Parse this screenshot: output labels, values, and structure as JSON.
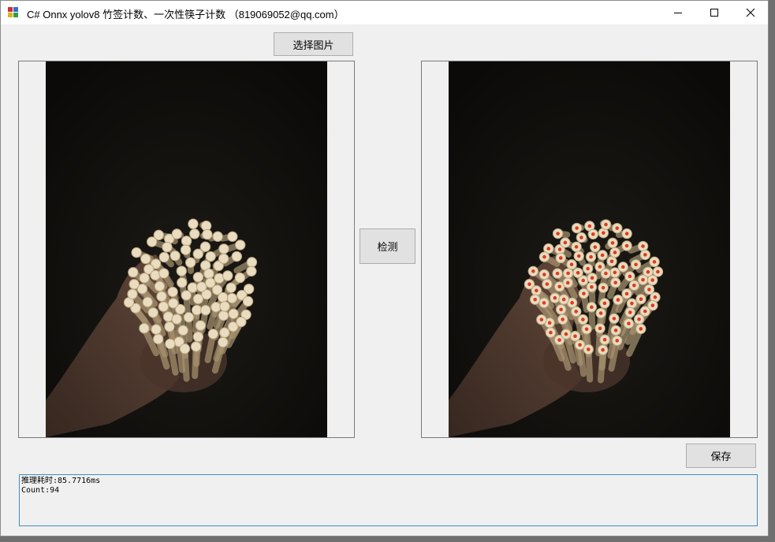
{
  "window": {
    "title": "C# Onnx yolov8 竹签计数、一次性筷子计数 （819069052@qq.com）",
    "controls": {
      "minimize": "minimize-icon",
      "maximize": "maximize-icon",
      "close": "close-icon"
    },
    "app_icon": "app-icon"
  },
  "buttons": {
    "select_image": "选择图片",
    "detect": "检测",
    "save": "保存"
  },
  "output": {
    "lines": [
      "推理耗时:85.7716ms",
      "Count:94"
    ]
  },
  "colors": {
    "detection_marker": "#e03a1e",
    "log_border": "#3c8fbf"
  }
}
